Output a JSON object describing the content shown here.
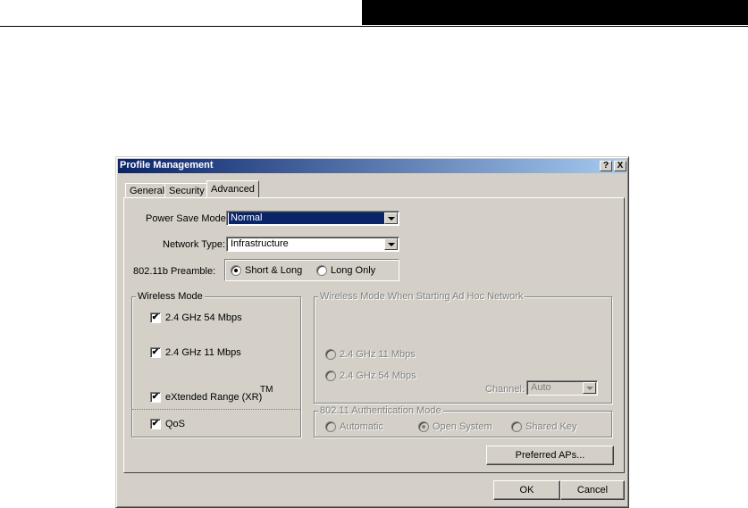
{
  "dialog": {
    "title": "Profile Management",
    "help_label": "?",
    "close_label": "X"
  },
  "tabs": [
    {
      "label": "General",
      "active": false
    },
    {
      "label": "Security",
      "active": false
    },
    {
      "label": "Advanced",
      "active": true
    }
  ],
  "power_save": {
    "label": "Power Save Mode:",
    "value": "Normal"
  },
  "network_type": {
    "label": "Network Type:",
    "value": "Infrastructure"
  },
  "preamble": {
    "label": "802.11b Preamble:",
    "options": [
      {
        "label": "Short & Long",
        "selected": true
      },
      {
        "label": "Long Only",
        "selected": false
      }
    ]
  },
  "wireless_mode": {
    "legend": "Wireless Mode",
    "options": [
      {
        "label": "2.4 GHz 54 Mbps",
        "checked": true
      },
      {
        "label": "2.4 GHz 11 Mbps",
        "checked": true
      },
      {
        "label": "eXtended Range (XR)",
        "checked": true
      }
    ],
    "xr_superscript": "TM",
    "qos": {
      "label": "QoS",
      "checked": true
    }
  },
  "adhoc_mode": {
    "legend": "Wireless Mode When Starting Ad Hoc Network",
    "options": [
      {
        "label": "2.4 GHz 11 Mbps",
        "selected": false
      },
      {
        "label": "2.4 GHz 54 Mbps",
        "selected": false
      }
    ],
    "channel_label": "Channel:",
    "channel_value": "Auto"
  },
  "auth_mode": {
    "legend": "802.11 Authentication Mode",
    "options": [
      {
        "label": "Automatic",
        "selected": false
      },
      {
        "label": "Open System",
        "selected": true
      },
      {
        "label": "Shared Key",
        "selected": false
      }
    ]
  },
  "buttons": {
    "preferred_aps": "Preferred APs...",
    "ok": "OK",
    "cancel": "Cancel"
  },
  "check_glyph": "✔"
}
